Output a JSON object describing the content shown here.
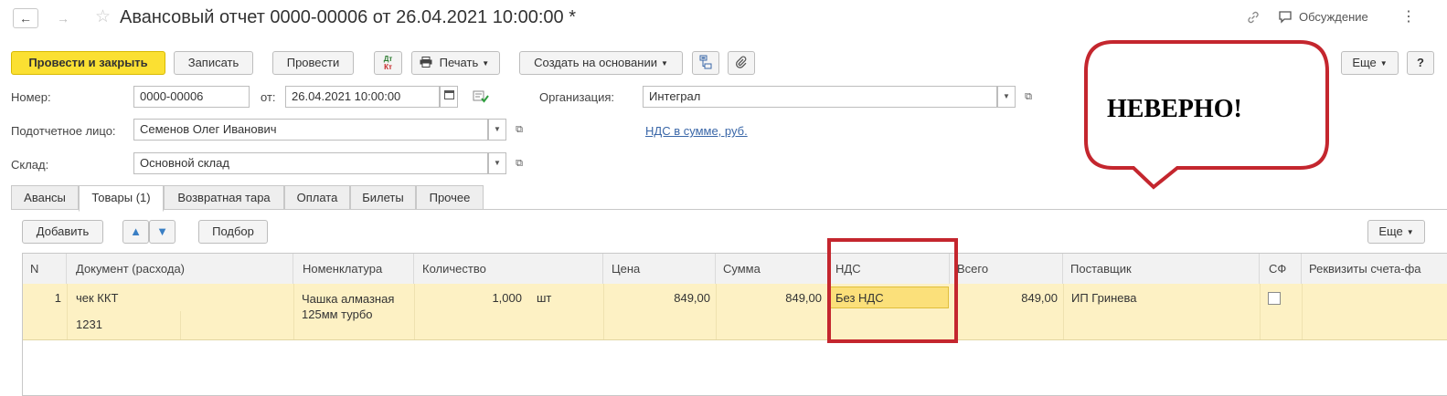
{
  "header": {
    "title": "Авансовый отчет 0000-00006 от 26.04.2021 10:00:00 *",
    "discussion": "Обсуждение"
  },
  "toolbar": {
    "post_close": "Провести и закрыть",
    "save": "Записать",
    "post": "Провести",
    "dtkt_top": "Дт",
    "dtkt_bottom": "Кт",
    "print": "Печать",
    "create_basis": "Создать на основании",
    "more": "Еще",
    "help": "?"
  },
  "form": {
    "number_label": "Номер:",
    "number_value": "0000-00006",
    "from_label": "от:",
    "date_value": "26.04.2021 10:00:00",
    "org_label": "Организация:",
    "org_value": "Интеграл",
    "person_label": "Подотчетное лицо:",
    "person_value": "Семенов Олег Иванович",
    "vat_link": "НДС в сумме, руб.",
    "warehouse_label": "Склад:",
    "warehouse_value": "Основной склад"
  },
  "tabs": [
    {
      "label": "Авансы"
    },
    {
      "label": "Товары (1)"
    },
    {
      "label": "Возвратная тара"
    },
    {
      "label": "Оплата"
    },
    {
      "label": "Билеты"
    },
    {
      "label": "Прочее"
    }
  ],
  "table_toolbar": {
    "add": "Добавить",
    "pick": "Подбор",
    "more": "Еще"
  },
  "table": {
    "columns": [
      "N",
      "Документ (расхода)",
      "Номенклатура",
      "Количество",
      "Цена",
      "Сумма",
      "НДС",
      "Всего",
      "Поставщик",
      "СФ",
      "Реквизиты счета-фа"
    ],
    "rows": [
      {
        "n": "1",
        "doc": "чек ККТ",
        "doc_number": "1231",
        "item_line1": "Чашка алмазная",
        "item_line2": "125мм турбо",
        "qty": "1,000",
        "unit": "шт",
        "price": "849,00",
        "sum": "849,00",
        "vat": "Без НДС",
        "total": "849,00",
        "supplier": "ИП Гринева"
      }
    ]
  },
  "annotation": {
    "bubble_text": "НЕВЕРНО!",
    "color": "#c4262e"
  }
}
